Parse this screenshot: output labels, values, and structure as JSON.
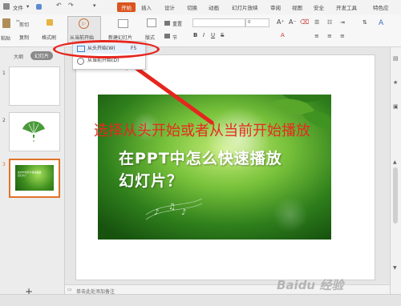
{
  "menubar": {
    "file": "文件",
    "tabs": [
      {
        "label": "开始",
        "active": true
      },
      {
        "label": "插入"
      },
      {
        "label": "设计"
      },
      {
        "label": "切换"
      },
      {
        "label": "动画"
      },
      {
        "label": "幻灯片放映"
      },
      {
        "label": "审阅"
      },
      {
        "label": "视图"
      },
      {
        "label": "安全"
      },
      {
        "label": "开发工具"
      },
      {
        "label": "特色应"
      }
    ],
    "accent": "#d9541f"
  },
  "ribbon": {
    "cut": "剪切",
    "paste": "粘贴",
    "copy": "复制",
    "format_painter": "格式刷",
    "play_from_current": "从当前开始",
    "new_slide": "新建幻灯片",
    "layout": "版式",
    "reset": "重置",
    "section": "节",
    "font_size": "0"
  },
  "dropdown": {
    "item1_label": "从头开始(W)",
    "item1_shortcut": "F5",
    "item2_label": "从当前开始(D)"
  },
  "panel": {
    "tab_outline": "大纲",
    "tab_slides": "幻灯片",
    "slide_numbers": [
      "1",
      "2",
      "3"
    ],
    "thumb3_text": "在PPT中怎么快速播放幻灯片？",
    "add_button": "+"
  },
  "slide": {
    "title_line1": "在PPT中怎么快速播放",
    "title_line2": "幻灯片？"
  },
  "annotation": {
    "instruction": "选择从头开始或者从当前开始播放",
    "color": "#e5261f"
  },
  "notes": {
    "placeholder": "单击此处添加备注"
  },
  "watermark": "Baidu 经验"
}
